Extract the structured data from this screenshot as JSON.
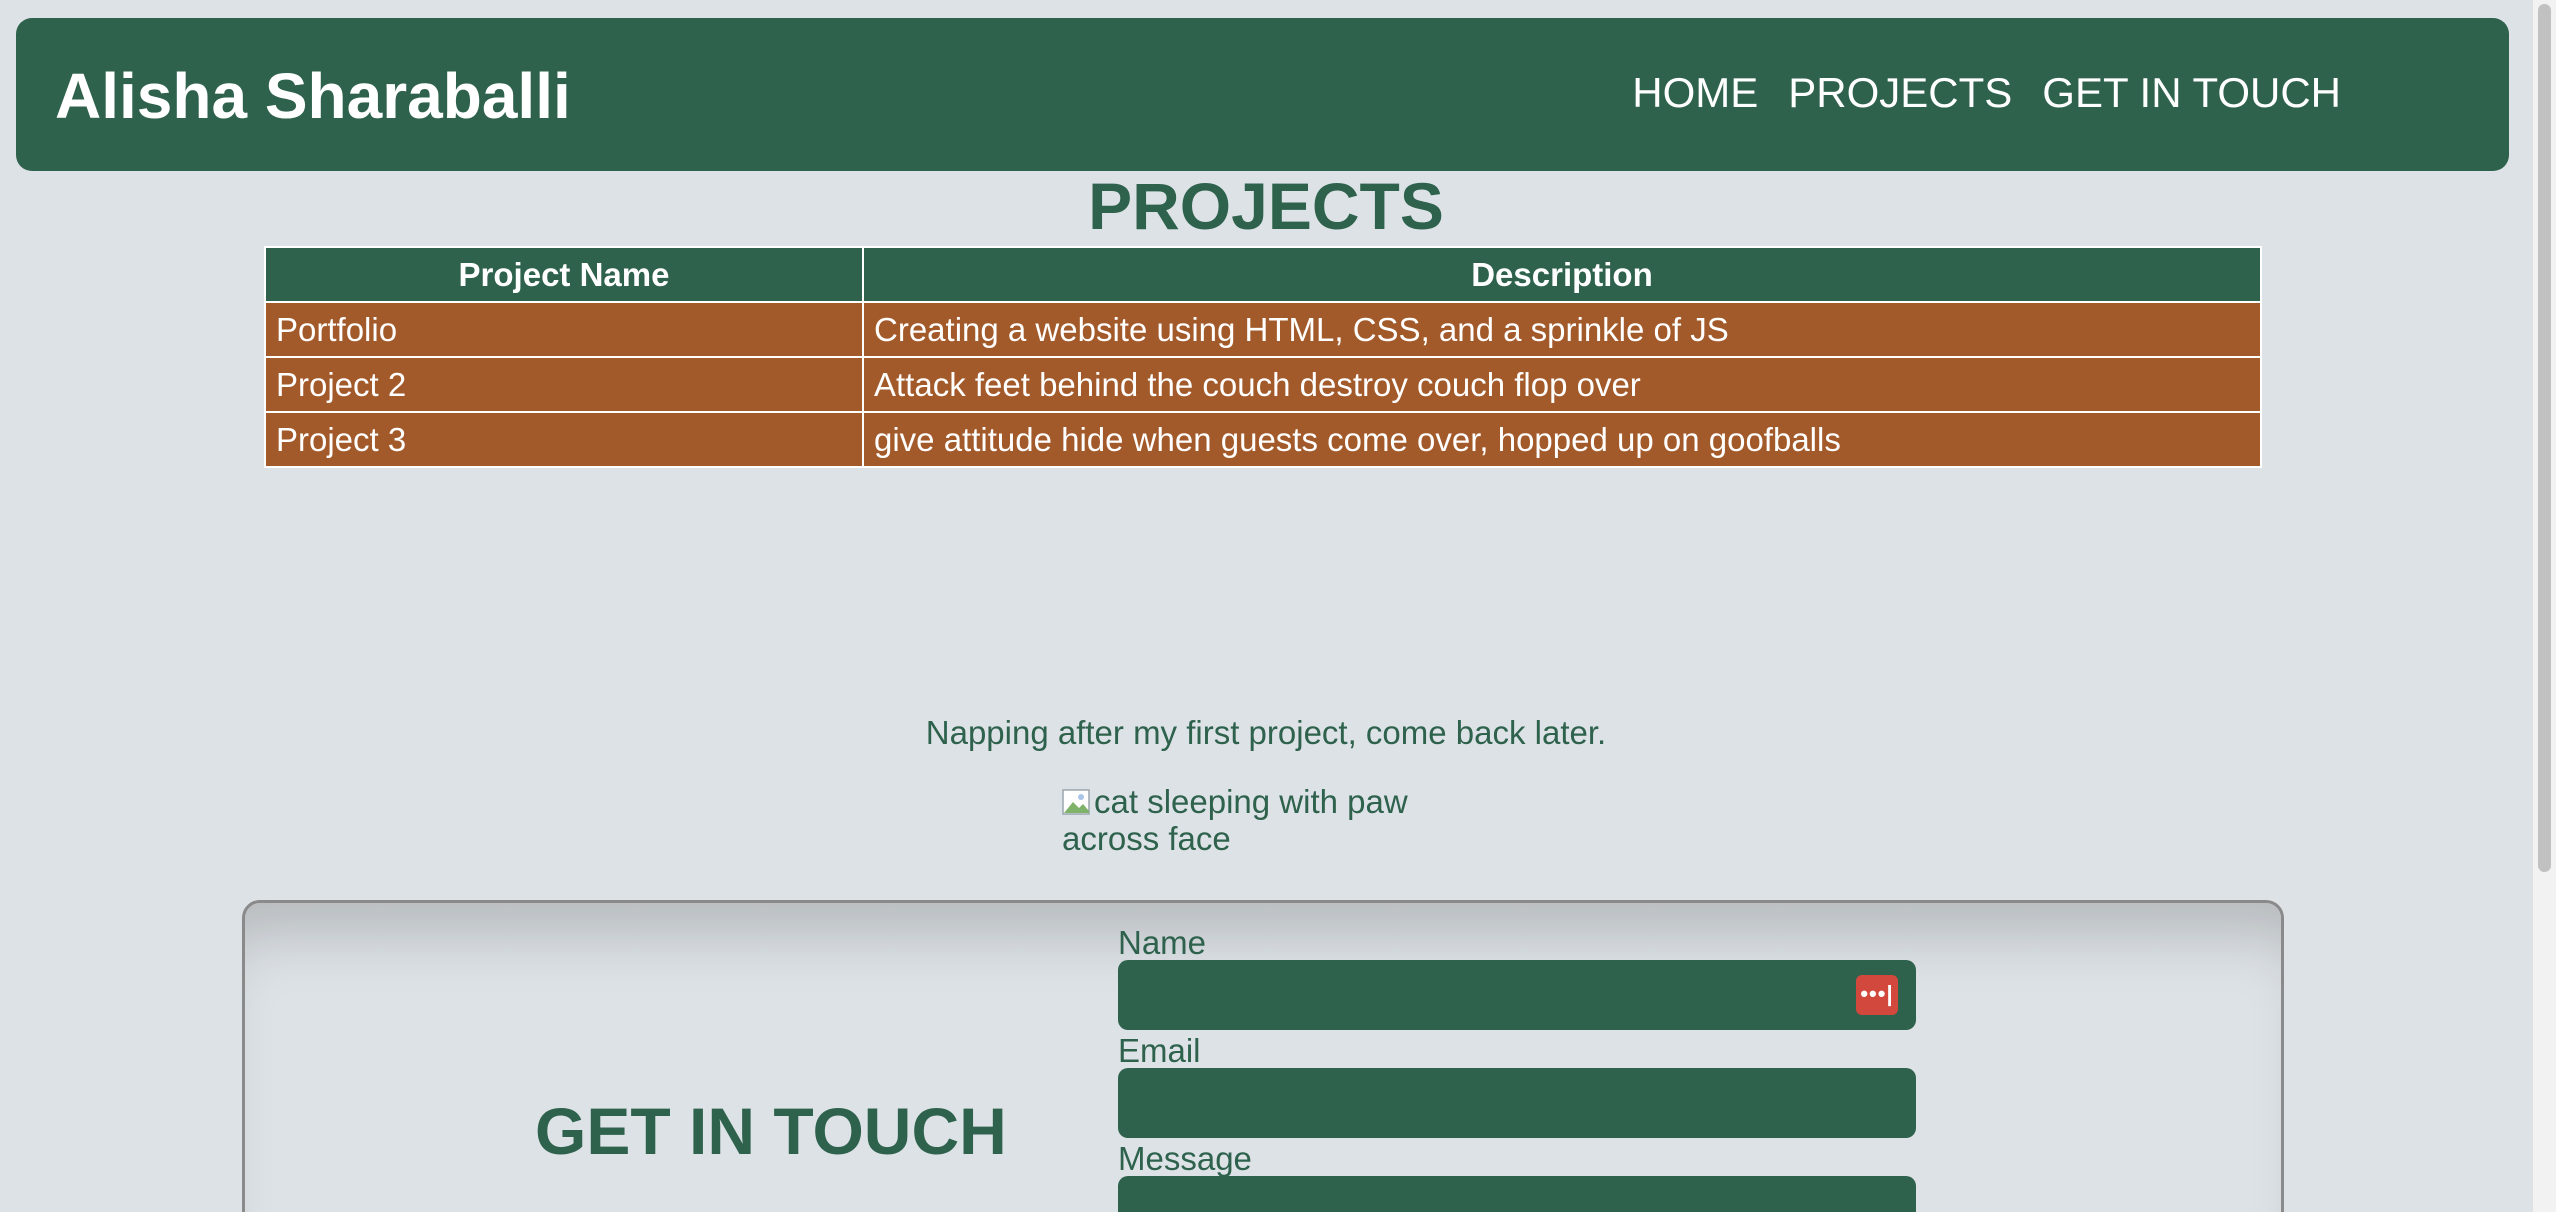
{
  "header": {
    "title": "Alisha Sharaballi",
    "nav": [
      "HOME",
      "PROJECTS",
      "GET IN TOUCH"
    ]
  },
  "projects": {
    "heading": "PROJECTS",
    "columns": [
      "Project Name",
      "Description"
    ],
    "rows": [
      [
        "Portfolio",
        "Creating a website using HTML, CSS, and a sprinkle of JS"
      ],
      [
        "Project 2",
        "Attack feet behind the couch destroy couch flop over"
      ],
      [
        "Project 3",
        "give attitude hide when guests come over, hopped up on goofballs"
      ]
    ]
  },
  "nap": {
    "text": "Napping after my first project, come back later.",
    "image_alt": "cat sleeping with paw across face"
  },
  "contact": {
    "heading": "GET IN TOUCH",
    "name_label": "Name",
    "email_label": "Email",
    "message_label": "Message",
    "password_manager_icon": "dots-key-icon"
  },
  "colors": {
    "primary": "#2e624d",
    "table_row": "#a35a2a",
    "background": "#dde2e6",
    "password_icon": "#d2483d"
  }
}
